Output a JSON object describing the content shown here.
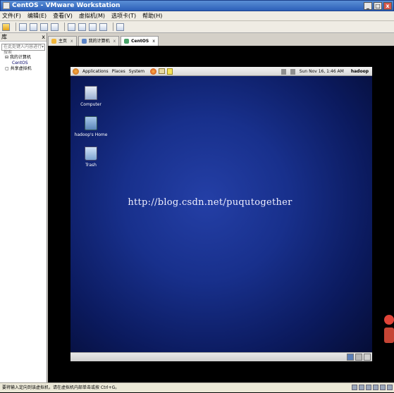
{
  "window": {
    "title": "CentOS - VMware Workstation"
  },
  "menu": [
    "文件(F)",
    "编辑(E)",
    "查看(V)",
    "虚拟机(M)",
    "选项卡(T)",
    "帮助(H)"
  ],
  "library": {
    "header": "库",
    "close": "x",
    "search_placeholder": "在此处键入内容进行搜索",
    "tree": {
      "my_computer": "我的计算机",
      "centos": "CentOS",
      "shared": "共享虚拟机"
    }
  },
  "tabs": [
    {
      "label": "主页",
      "close": "x",
      "color": "#f2b63a"
    },
    {
      "label": "我的计算机",
      "close": "x",
      "color": "#5b84c7"
    },
    {
      "label": "CentOS",
      "close": "x",
      "color": "#4aa36a"
    }
  ],
  "guest": {
    "panel": {
      "applications": "Applications",
      "places": "Places",
      "system": "System",
      "clock": "Sun Nov 16,  1:46 AM",
      "user": "hadoop"
    },
    "desktop_icons": {
      "computer": "Computer",
      "home": "hadoop's Home",
      "trash": "Trash"
    },
    "watermark": "http://blog.csdn.net/puqutogether"
  },
  "statusbar": {
    "text": "要将输入定向到该虚拟机，请在虚拟机内部单击或按 Ctrl+G。"
  },
  "title_controls": {
    "minimize": "_",
    "maximize": "□",
    "close": "x"
  }
}
